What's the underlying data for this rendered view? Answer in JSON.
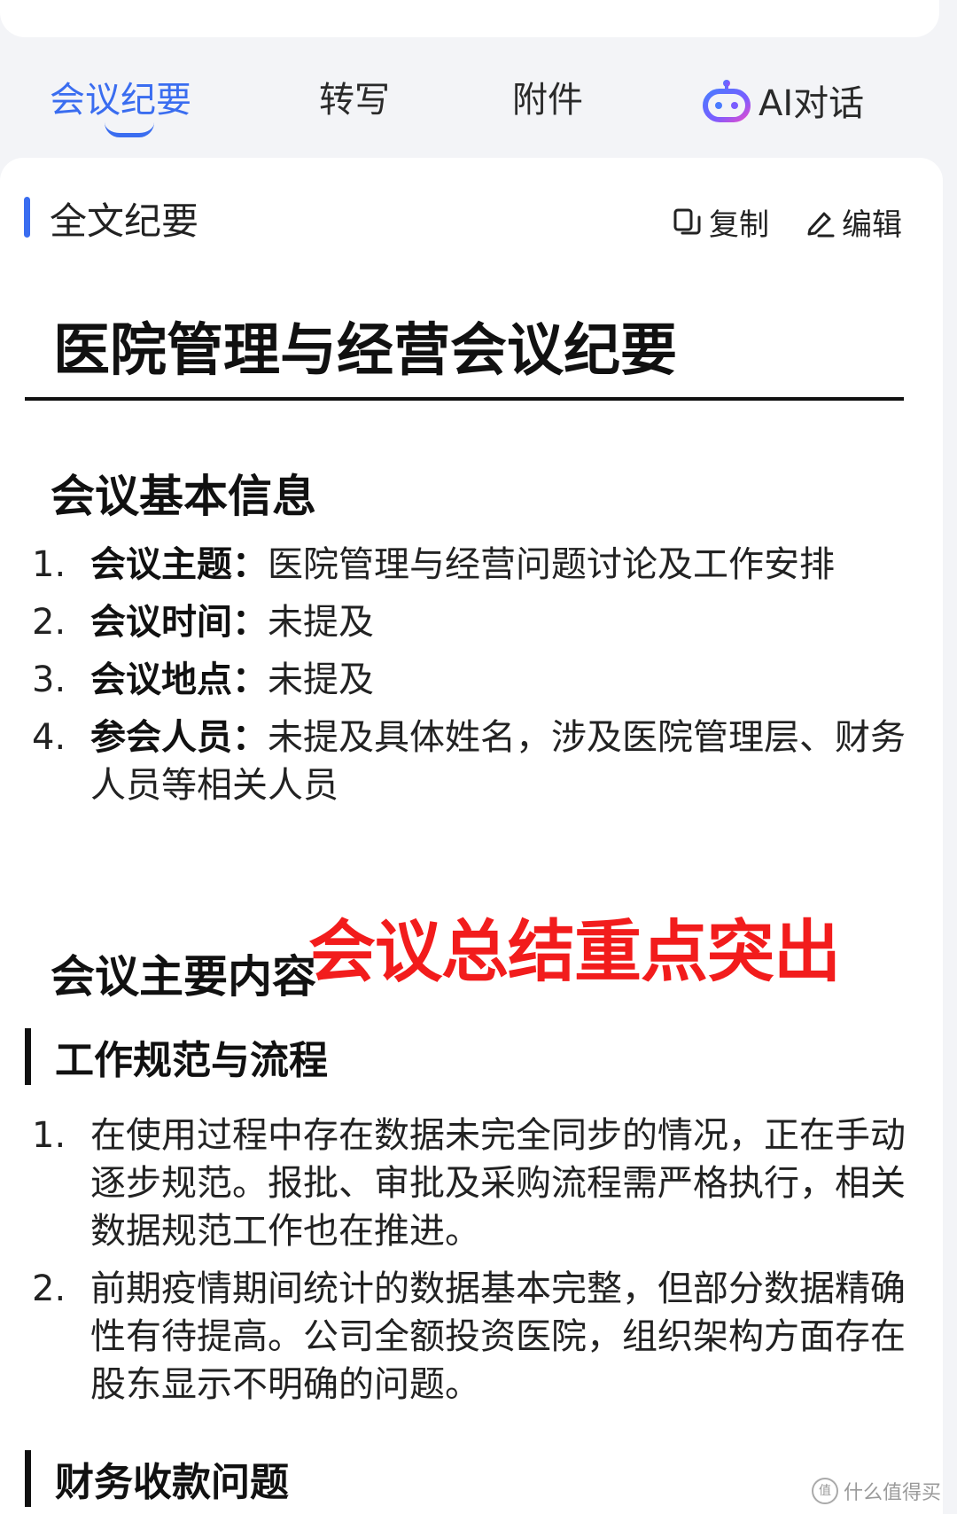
{
  "tabs": [
    {
      "label": "会议纪要"
    },
    {
      "label": "转写"
    },
    {
      "label": "附件"
    },
    {
      "label": "AI对话"
    }
  ],
  "section": {
    "title": "全文纪要",
    "copy_label": "复制",
    "edit_label": "编辑"
  },
  "doc": {
    "title": "医院管理与经营会议纪要",
    "basic_heading": "会议基本信息",
    "basic_items": [
      {
        "num": "1.",
        "label": "会议主题：",
        "text": "医院管理与经营问题讨论及工作安排"
      },
      {
        "num": "2.",
        "label": "会议时间：",
        "text": "未提及"
      },
      {
        "num": "3.",
        "label": "会议地点：",
        "text": "未提及"
      },
      {
        "num": "4.",
        "label": "参会人员：",
        "text": "未提及具体姓名，涉及医院管理层、财务人员等相关人员"
      }
    ],
    "main_heading": "会议主要内容",
    "sub1_heading": "工作规范与流程",
    "sub1_items": [
      {
        "num": "1.",
        "text": "在使用过程中存在数据未完全同步的情况，正在手动逐步规范。报批、审批及采购流程需严格执行，相关数据规范工作也在推进。"
      },
      {
        "num": "2.",
        "text": "前期疫情期间统计的数据基本完整，但部分数据精确性有待提高。公司全额投资医院，组织架构方面存在股东显示不明确的问题。"
      }
    ],
    "sub2_heading": "财务收款问题"
  },
  "overlay_text": "会议总结重点突出",
  "watermark": "什么值得买",
  "colors": {
    "accent": "#3a6df0",
    "overlay": "#f21c1c"
  }
}
